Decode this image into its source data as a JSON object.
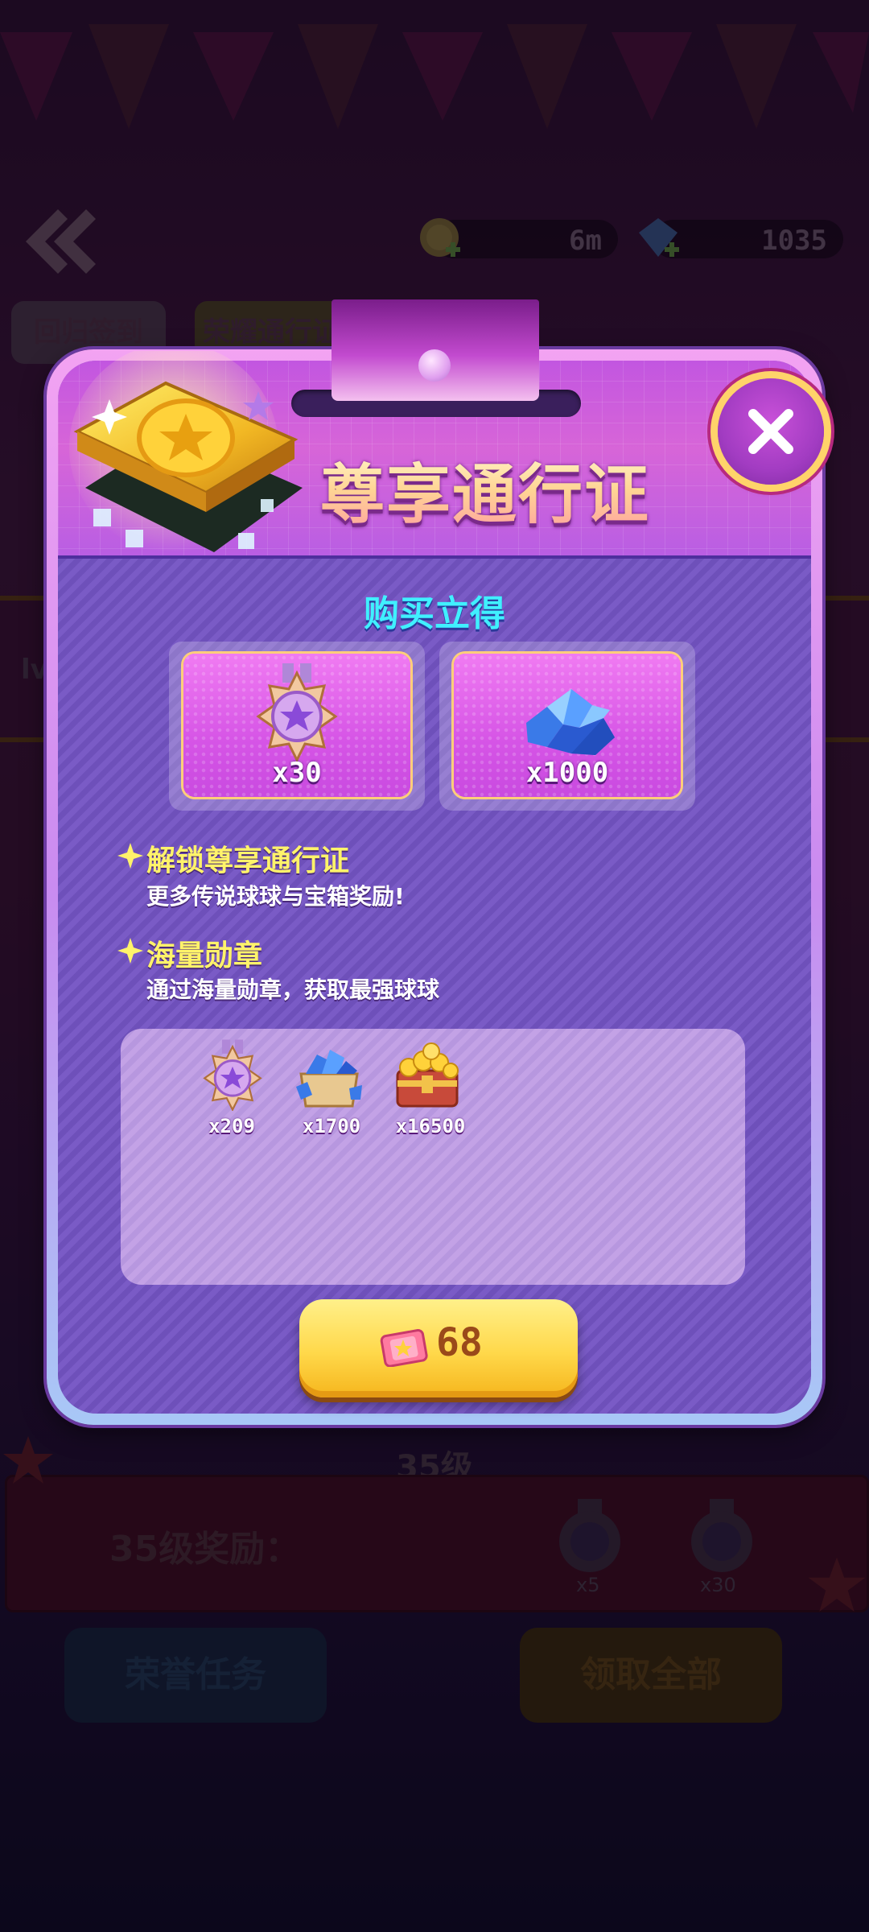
{
  "background": {
    "distance": "6m",
    "gems": "1035",
    "tabs": [
      "回归签到",
      "荣耀通行证"
    ],
    "level_label": "lv",
    "level_banner": "35级",
    "reward_title": "35级奖励：",
    "reward_counts": [
      "x5",
      "x30"
    ],
    "left_button": "荣誉任务",
    "right_button": "领取全部"
  },
  "modal": {
    "title": "尊享通行证",
    "subtitle": "购买立得",
    "instant_rewards": [
      {
        "icon": "medal-icon",
        "count": "x30"
      },
      {
        "icon": "gem-pile-icon",
        "count": "x1000"
      }
    ],
    "features": [
      {
        "title": "解锁尊享通行证",
        "desc": "更多传说球球与宝箱奖励!"
      },
      {
        "title": "海量勋章",
        "desc": "通过海量勋章，获取最强球球"
      }
    ],
    "total_rewards": [
      {
        "icon": "medal-icon",
        "count": "x209"
      },
      {
        "icon": "gem-crate-icon",
        "count": "x1700"
      },
      {
        "icon": "gold-chest-icon",
        "count": "x16500"
      }
    ],
    "buy_button": {
      "icon": "ticket-icon",
      "price": "68"
    },
    "close_icon": "close-icon"
  }
}
